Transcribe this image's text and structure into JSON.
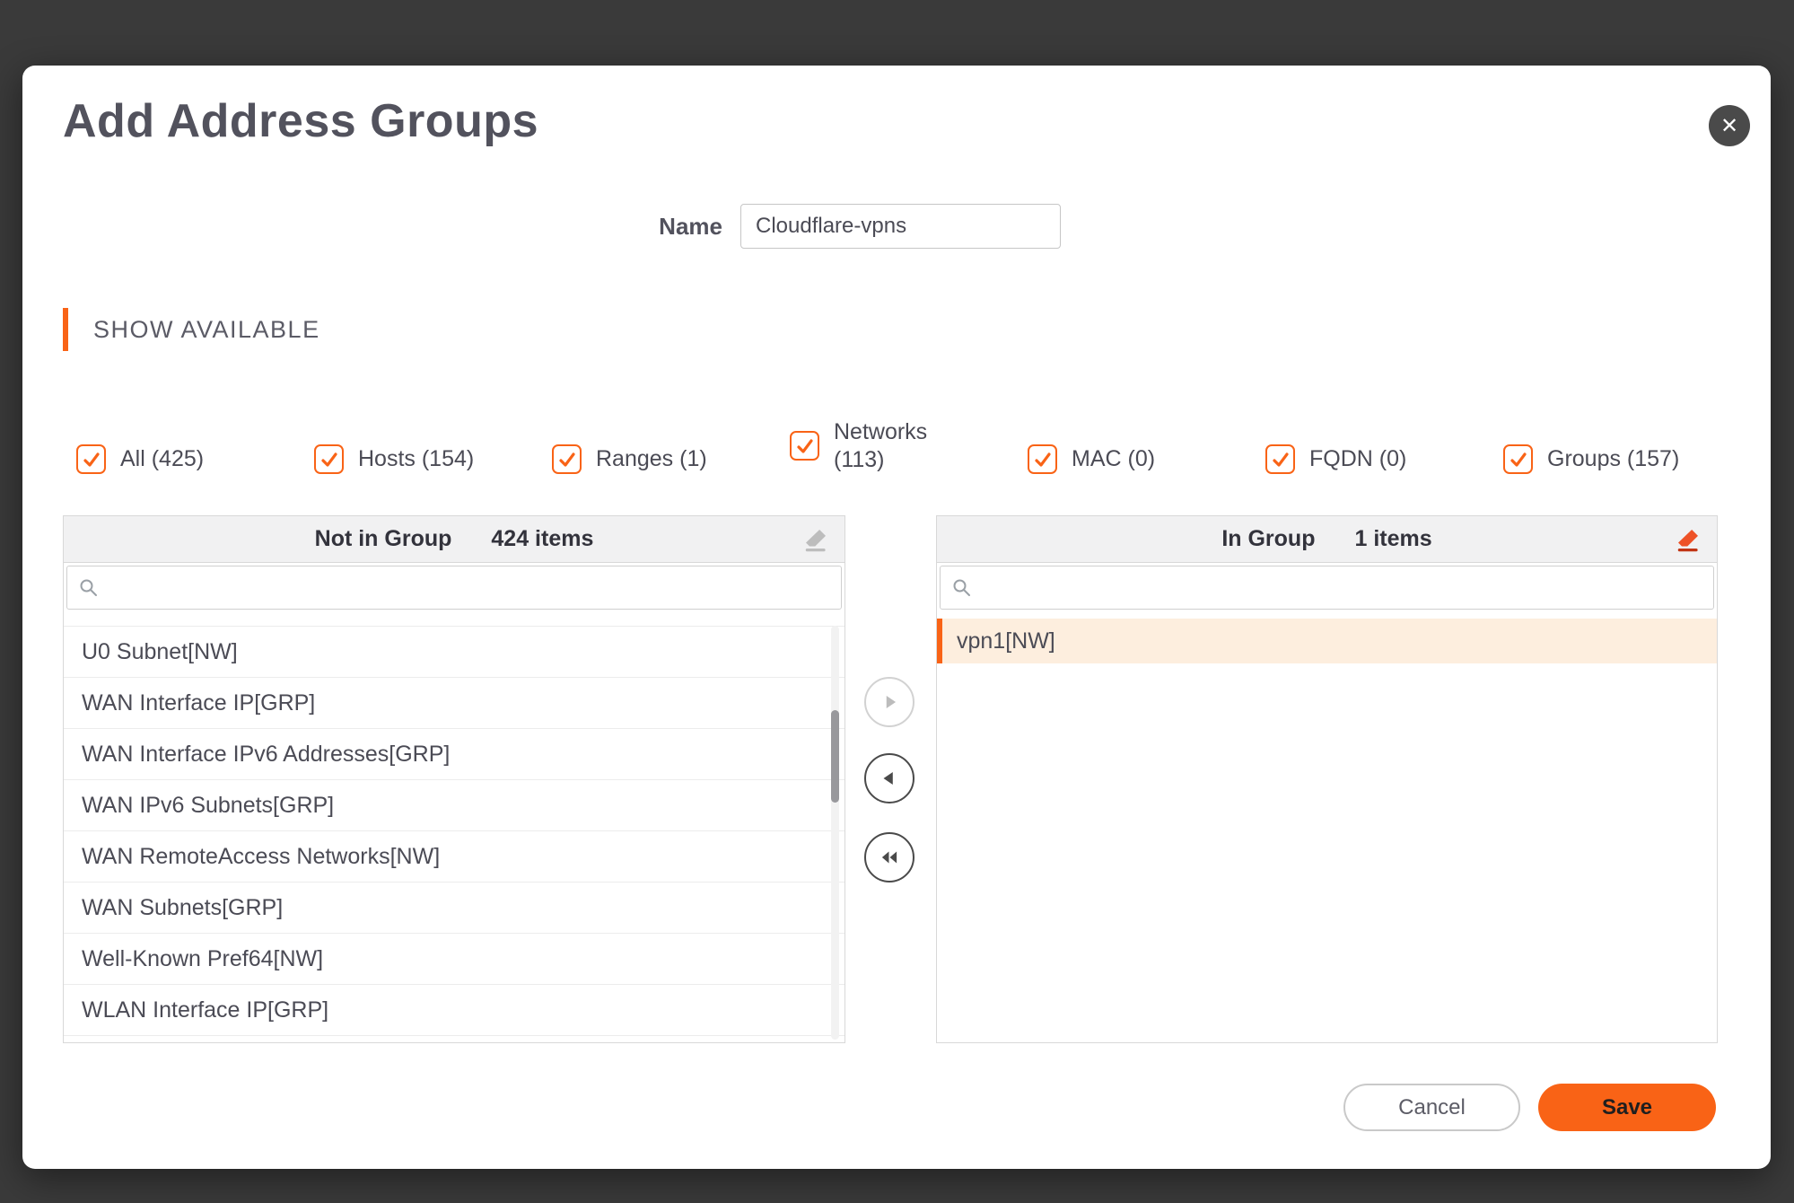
{
  "colors": {
    "accent": "#F96316",
    "overlay": "#3a3a3a",
    "selected_row_bg": "#fdeede",
    "panel_header_bg": "#f1f1f2"
  },
  "dialog": {
    "title": "Add Address Groups",
    "close_glyph": "✕"
  },
  "name_field": {
    "label": "Name",
    "value": "Cloudflare-vpns"
  },
  "section": {
    "header": "SHOW AVAILABLE"
  },
  "filters": {
    "items": [
      {
        "label": "All (425)",
        "checked": true
      },
      {
        "label": "Hosts (154)",
        "checked": true
      },
      {
        "label": "Ranges (1)",
        "checked": true
      },
      {
        "label": "Networks (113)",
        "checked": true
      },
      {
        "label": "MAC (0)",
        "checked": true
      },
      {
        "label": "FQDN (0)",
        "checked": true
      },
      {
        "label": "Groups (157)",
        "checked": true
      }
    ]
  },
  "not_in_group": {
    "title": "Not in Group",
    "count": "424 items",
    "search_placeholder": "",
    "items": [
      "U0 Subnet[NW]",
      "WAN Interface IP[GRP]",
      "WAN Interface IPv6 Addresses[GRP]",
      "WAN IPv6 Subnets[GRP]",
      "WAN RemoteAccess Networks[NW]",
      "WAN Subnets[GRP]",
      "Well-Known Pref64[NW]",
      "WLAN Interface IP[GRP]"
    ]
  },
  "in_group": {
    "title": "In Group",
    "count": "1 items",
    "search_placeholder": "",
    "items": [
      "vpn1[NW]"
    ]
  },
  "icons": {
    "close": "close-icon",
    "search": "search-icon",
    "clear_list": "eraser-icon",
    "move_right": "triangle-right-icon",
    "move_left": "triangle-left-icon",
    "move_all_left": "double-triangle-left-icon"
  },
  "actions": {
    "cancel": "Cancel",
    "save": "Save"
  }
}
